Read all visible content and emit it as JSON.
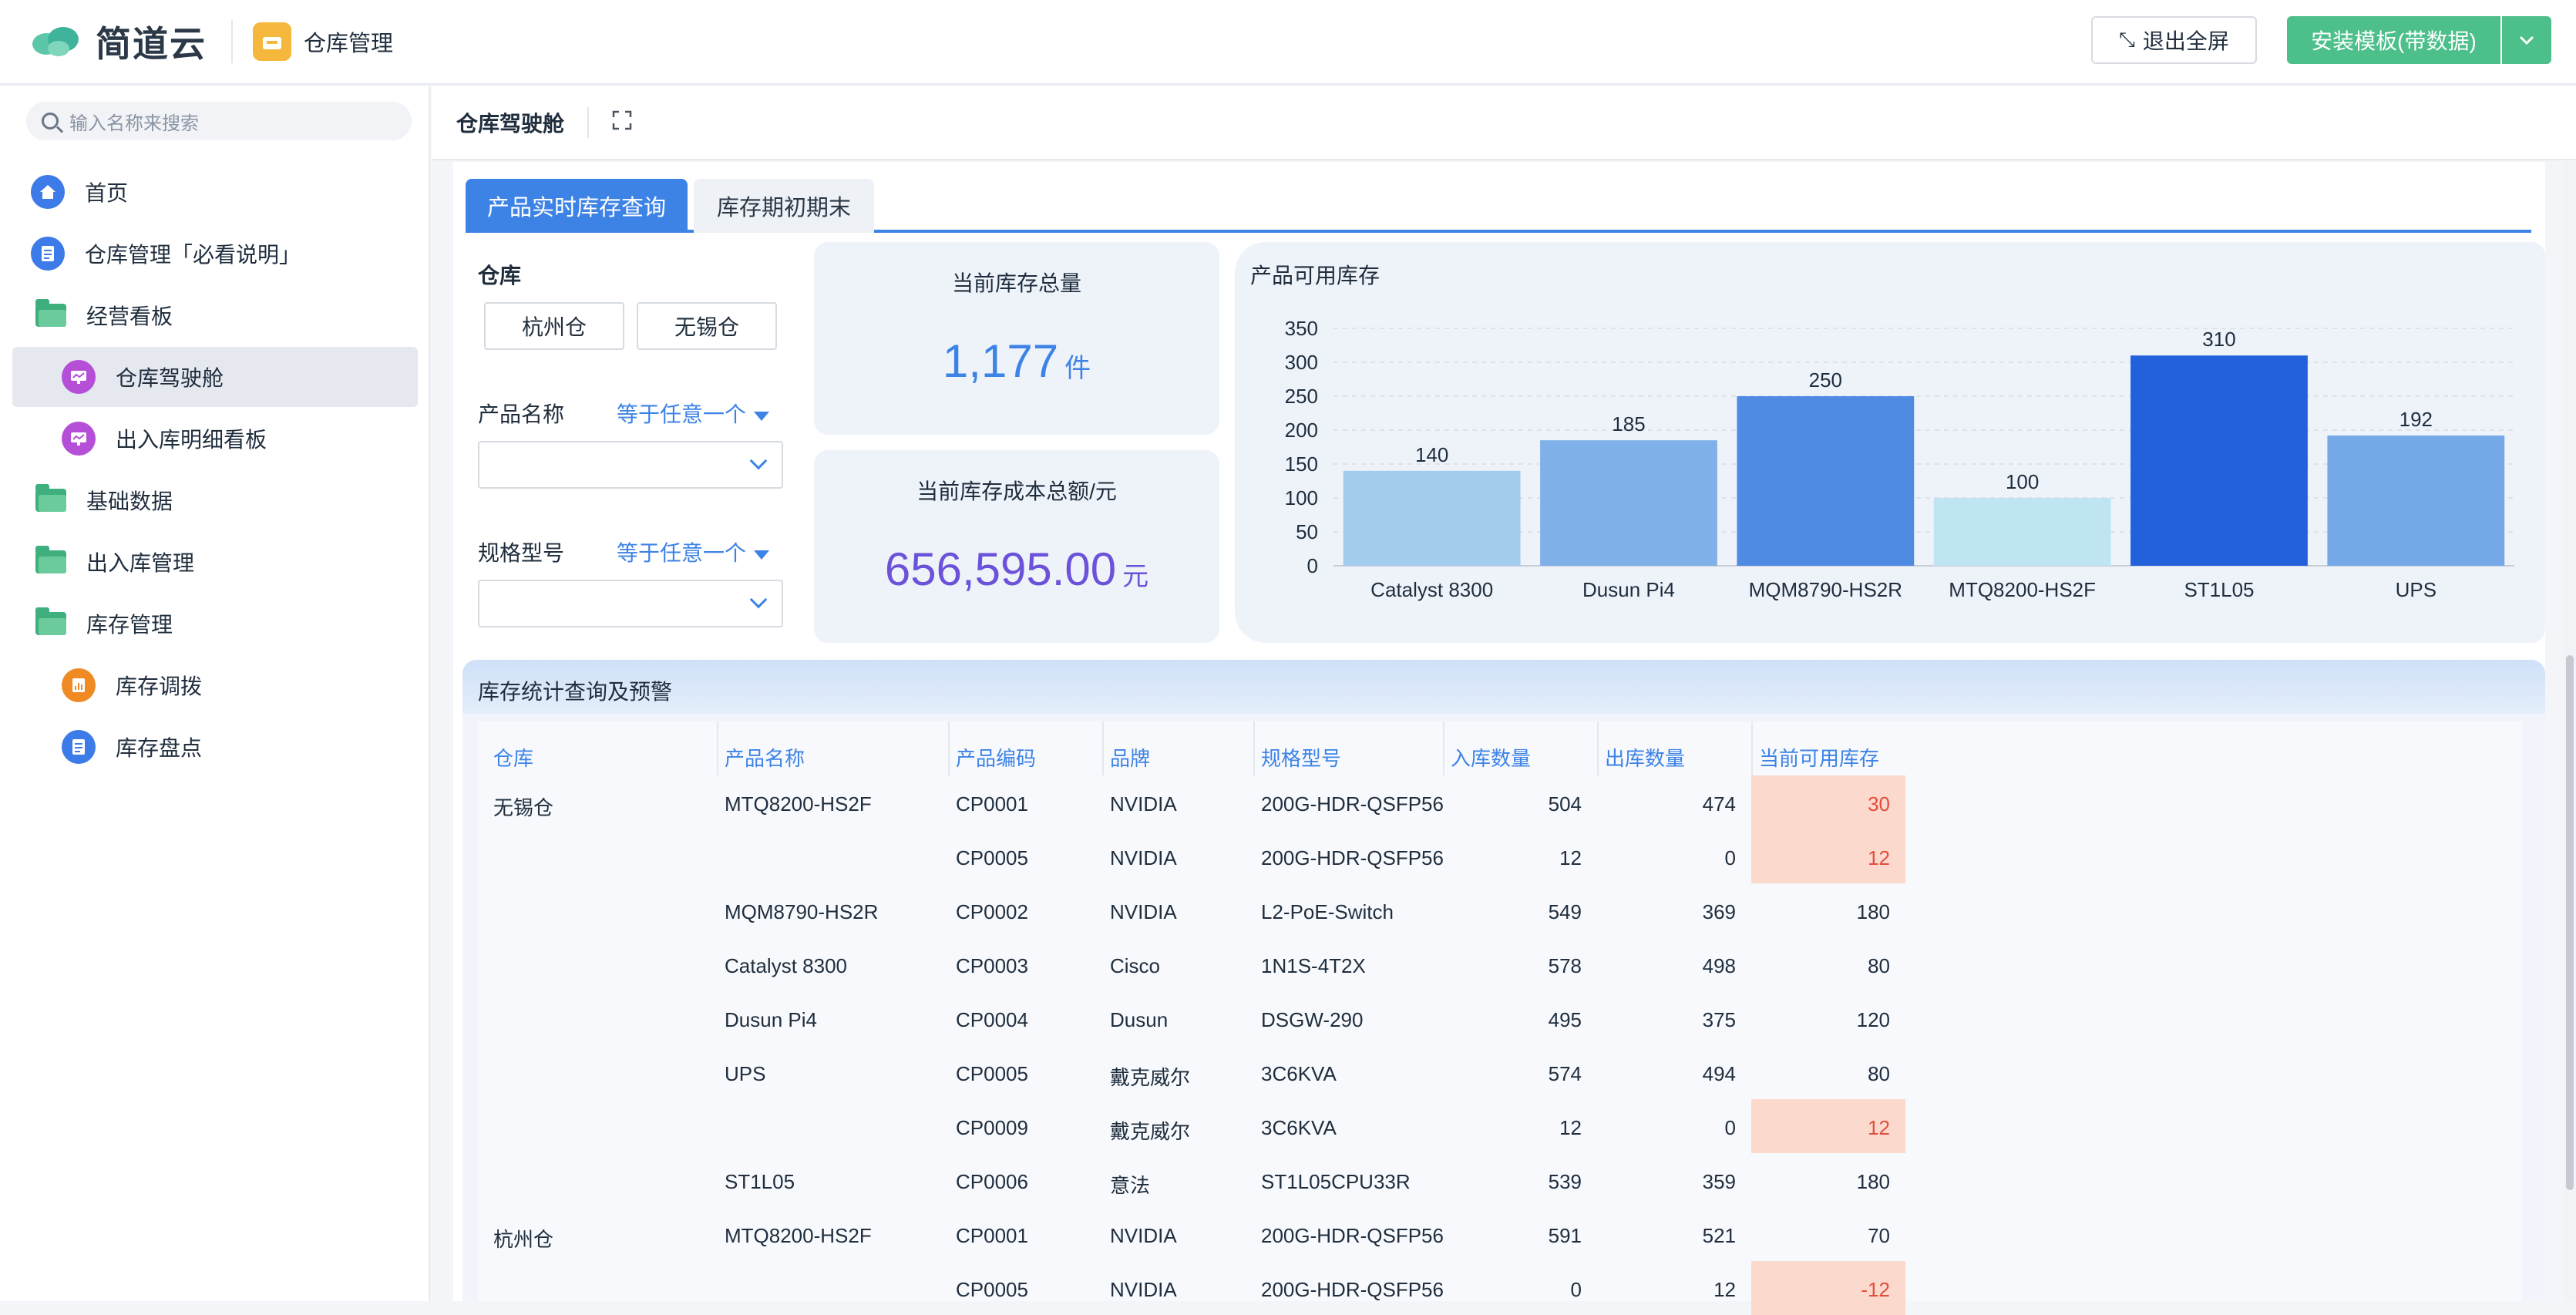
{
  "header": {
    "brand": "简道云",
    "app_name": "仓库管理",
    "exit_fullscreen": "退出全屏",
    "install_template": "安装模板(带数据)"
  },
  "sidebar": {
    "search_placeholder": "输入名称来搜索",
    "items": [
      {
        "label": "首页",
        "icon": "home-icon"
      },
      {
        "label": "仓库管理「必看说明」",
        "icon": "document-icon"
      },
      {
        "label": "经营看板",
        "icon": "folder-icon"
      },
      {
        "label": "仓库驾驶舱",
        "icon": "dashboard-icon",
        "active": true
      },
      {
        "label": "出入库明细看板",
        "icon": "dashboard-icon"
      },
      {
        "label": "基础数据",
        "icon": "folder-icon"
      },
      {
        "label": "出入库管理",
        "icon": "folder-icon"
      },
      {
        "label": "库存管理",
        "icon": "folder-icon"
      },
      {
        "label": "库存调拨",
        "icon": "transfer-icon"
      },
      {
        "label": "库存盘点",
        "icon": "document-icon"
      }
    ]
  },
  "page": {
    "title": "仓库驾驶舱"
  },
  "tabs": [
    "产品实时库存查询",
    "库存期初期末"
  ],
  "filters": {
    "warehouse_label": "仓库",
    "warehouse_options": [
      "杭州仓",
      "无锡仓"
    ],
    "product_label": "产品名称",
    "product_condition": "等于任意一个",
    "spec_label": "规格型号",
    "spec_condition": "等于任意一个"
  },
  "kpis": {
    "total_stock_title": "当前库存总量",
    "total_stock_value": "1,177",
    "total_stock_unit": "件",
    "total_cost_title": "当前库存成本总额/元",
    "total_cost_value": "656,595.00",
    "total_cost_unit": "元"
  },
  "chart_title": "产品可用库存",
  "chart_data": {
    "type": "bar",
    "categories": [
      "Catalyst 8300",
      "Dusun Pi4",
      "MQM8790-HS2R",
      "MTQ8200-HS2F",
      "ST1L05",
      "UPS"
    ],
    "values": [
      140,
      185,
      250,
      100,
      310,
      192
    ],
    "colors": [
      "#a3cdee",
      "#7fb1e8",
      "#4f8be3",
      "#bfe5f3",
      "#2360dc",
      "#74a8e6"
    ],
    "yticks": [
      0,
      50,
      100,
      150,
      200,
      250,
      300,
      350
    ],
    "ylim": [
      0,
      350
    ],
    "grid": true
  },
  "table": {
    "title": "库存统计查询及预警",
    "headers": [
      "仓库",
      "产品名称",
      "产品编码",
      "品牌",
      "规格型号",
      "入库数量",
      "出库数量",
      "当前可用库存"
    ],
    "rows": [
      {
        "warehouse": "无锡仓",
        "product": "MTQ8200-HS2F",
        "code": "CP0001",
        "brand": "NVIDIA",
        "spec": "200G-HDR-QSFP56",
        "in": "504",
        "out": "474",
        "avail": "30",
        "warn": true
      },
      {
        "warehouse": "",
        "product": "",
        "code": "CP0005",
        "brand": "NVIDIA",
        "spec": "200G-HDR-QSFP56",
        "in": "12",
        "out": "0",
        "avail": "12",
        "warn": true
      },
      {
        "warehouse": "",
        "product": "MQM8790-HS2R",
        "code": "CP0002",
        "brand": "NVIDIA",
        "spec": "L2-PoE-Switch",
        "in": "549",
        "out": "369",
        "avail": "180",
        "warn": false
      },
      {
        "warehouse": "",
        "product": "Catalyst 8300",
        "code": "CP0003",
        "brand": "Cisco",
        "spec": "1N1S-4T2X",
        "in": "578",
        "out": "498",
        "avail": "80",
        "warn": false
      },
      {
        "warehouse": "",
        "product": "Dusun Pi4",
        "code": "CP0004",
        "brand": "Dusun",
        "spec": "DSGW-290",
        "in": "495",
        "out": "375",
        "avail": "120",
        "warn": false
      },
      {
        "warehouse": "",
        "product": "UPS",
        "code": "CP0005",
        "brand": "戴克威尔",
        "spec": "3C6KVA",
        "in": "574",
        "out": "494",
        "avail": "80",
        "warn": false
      },
      {
        "warehouse": "",
        "product": "",
        "code": "CP0009",
        "brand": "戴克威尔",
        "spec": "3C6KVA",
        "in": "12",
        "out": "0",
        "avail": "12",
        "warn": true
      },
      {
        "warehouse": "",
        "product": "ST1L05",
        "code": "CP0006",
        "brand": "意法",
        "spec": "ST1L05CPU33R",
        "in": "539",
        "out": "359",
        "avail": "180",
        "warn": false
      },
      {
        "warehouse": "杭州仓",
        "product": "MTQ8200-HS2F",
        "code": "CP0001",
        "brand": "NVIDIA",
        "spec": "200G-HDR-QSFP56",
        "in": "591",
        "out": "521",
        "avail": "70",
        "warn": false
      },
      {
        "warehouse": "",
        "product": "",
        "code": "CP0005",
        "brand": "NVIDIA",
        "spec": "200G-HDR-QSFP56",
        "in": "0",
        "out": "12",
        "avail": "-12",
        "warn": true
      }
    ]
  }
}
